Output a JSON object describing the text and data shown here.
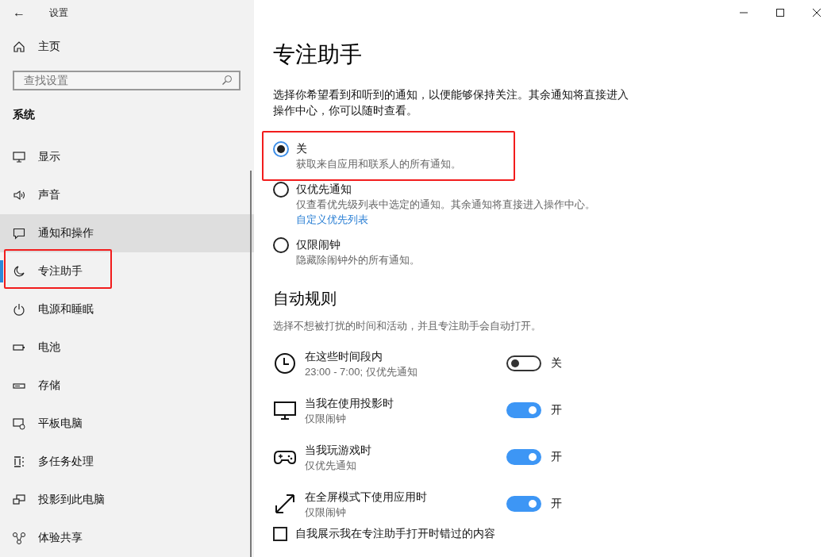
{
  "window": {
    "title": "设置",
    "back": "←"
  },
  "sidebar": {
    "home": "主页",
    "search": {
      "placeholder": "查找设置"
    },
    "section": "系统",
    "items": [
      {
        "label": "显示",
        "selected": false,
        "hovered": false,
        "highlighted": false
      },
      {
        "label": "声音",
        "selected": false,
        "hovered": false,
        "highlighted": false
      },
      {
        "label": "通知和操作",
        "selected": false,
        "hovered": true,
        "highlighted": false
      },
      {
        "label": "专注助手",
        "selected": true,
        "hovered": false,
        "highlighted": true
      },
      {
        "label": "电源和睡眠",
        "selected": false,
        "hovered": false,
        "highlighted": false
      },
      {
        "label": "电池",
        "selected": false,
        "hovered": false,
        "highlighted": false
      },
      {
        "label": "存储",
        "selected": false,
        "hovered": false,
        "highlighted": false
      },
      {
        "label": "平板电脑",
        "selected": false,
        "hovered": false,
        "highlighted": false
      },
      {
        "label": "多任务处理",
        "selected": false,
        "hovered": false,
        "highlighted": false
      },
      {
        "label": "投影到此电脑",
        "selected": false,
        "hovered": false,
        "highlighted": false
      },
      {
        "label": "体验共享",
        "selected": false,
        "hovered": false,
        "highlighted": false
      }
    ]
  },
  "main": {
    "title": "专注助手",
    "description": "选择你希望看到和听到的通知，以便能够保持关注。其余通知将直接进入操作中心，你可以随时查看。",
    "options": [
      {
        "label": "关",
        "detail": "获取来自应用和联系人的所有通知。",
        "selected": true,
        "highlighted": true
      },
      {
        "label": "仅优先通知",
        "detail": "仅查看优先级列表中选定的通知。其余通知将直接进入操作中心。",
        "link": "自定义优先列表",
        "selected": false,
        "highlighted": false
      },
      {
        "label": "仅限闹钟",
        "detail": "隐藏除闹钟外的所有通知。",
        "selected": false,
        "highlighted": false
      }
    ],
    "rules_title": "自动规则",
    "rules_description": "选择不想被打扰的时间和活动，并且专注助手会自动打开。",
    "rules": [
      {
        "label": "在这些时间段内",
        "detail": "23:00 - 7:00; 仅优先通知",
        "on": false,
        "state_text": "关"
      },
      {
        "label": "当我在使用投影时",
        "detail": "仅限闹钟",
        "on": true,
        "state_text": "开"
      },
      {
        "label": "当我玩游戏时",
        "detail": "仅优先通知",
        "on": true,
        "state_text": "开"
      },
      {
        "label": "在全屏模式下使用应用时",
        "detail": "仅限闹钟",
        "on": true,
        "state_text": "开"
      }
    ],
    "checkbox": {
      "label": "自我展示我在专注助手打开时错过的内容",
      "checked": false
    }
  }
}
